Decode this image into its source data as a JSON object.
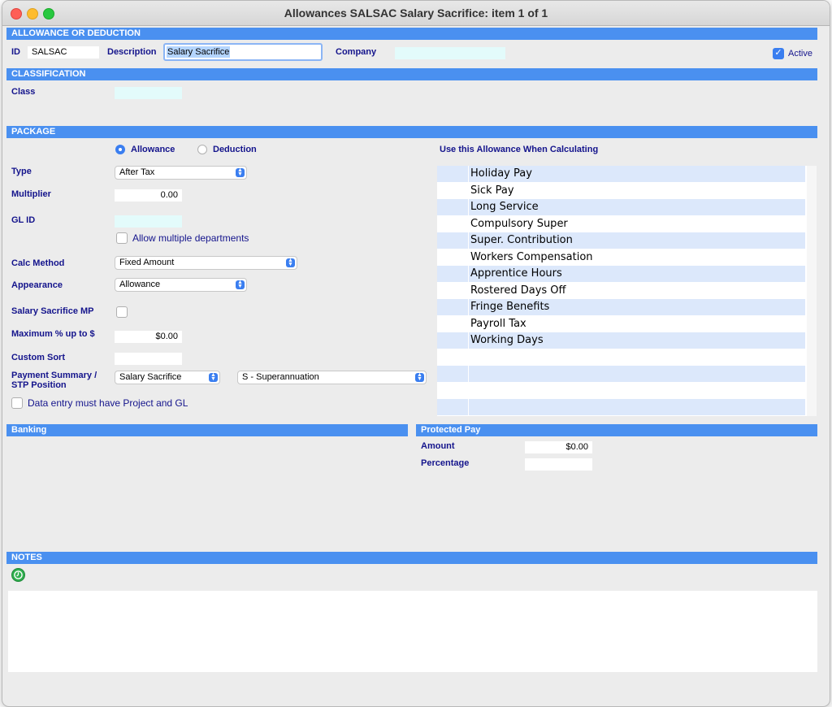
{
  "window": {
    "title": "Allowances SALSAC Salary Sacrifice: item 1  of  1"
  },
  "sections": {
    "allowance": "ALLOWANCE OR DEDUCTION",
    "classification": "CLASSIFICATION",
    "package": "PACKAGE",
    "banking": "Banking",
    "protected_pay": "Protected Pay",
    "notes": "NOTES"
  },
  "allowance": {
    "id_label": "ID",
    "id_value": "SALSAC",
    "description_label": "Description",
    "description_value": "Salary Sacrifice",
    "company_label": "Company",
    "company_value": "",
    "active_label": "Active",
    "active_checked": true
  },
  "classification": {
    "class_label": "Class",
    "class_value": ""
  },
  "package": {
    "radio_allowance": "Allowance",
    "radio_deduction": "Deduction",
    "selected": "Allowance",
    "type_label": "Type",
    "type_value": "After Tax",
    "multiplier_label": "Multiplier",
    "multiplier_value": "0.00",
    "glid_label": "GL ID",
    "glid_value": "",
    "allow_multi_dept": "Allow multiple departments",
    "calc_method_label": "Calc Method",
    "calc_method_value": "Fixed Amount",
    "appearance_label": "Appearance",
    "appearance_value": "Allowance",
    "salary_sacrifice_mp_label": "Salary Sacrifice MP",
    "max_pct_label": "Maximum % up to $",
    "max_pct_value": "$0.00",
    "custom_sort_label": "Custom Sort",
    "custom_sort_value": "",
    "payment_summary_label_1": "Payment Summary /",
    "payment_summary_label_2": "STP Position",
    "payment_summary_value": "Salary Sacrifice",
    "stp_position_value": "S - Superannuation",
    "data_entry_label": "Data entry must have Project and GL",
    "calc_heading": "Use this Allowance When Calculating",
    "calc_list": [
      "Holiday Pay",
      "Sick Pay",
      "Long Service",
      "Compulsory Super",
      "Super. Contribution",
      "Workers Compensation",
      "Apprentice Hours",
      "Rostered Days Off",
      "Fringe Benefits",
      "Payroll Tax",
      "Working Days",
      "",
      "",
      "",
      ""
    ]
  },
  "protected_pay": {
    "amount_label": "Amount",
    "amount_value": "$0.00",
    "percentage_label": "Percentage",
    "percentage_value": ""
  },
  "icons": {
    "notes_timestamp": "clock-icon"
  },
  "colors": {
    "section_header": "#4a90f0",
    "label": "#14148c",
    "accent": "#3a7ef0",
    "list_alt_row": "#dce8fb",
    "cyan_field": "#e3fbfb"
  }
}
